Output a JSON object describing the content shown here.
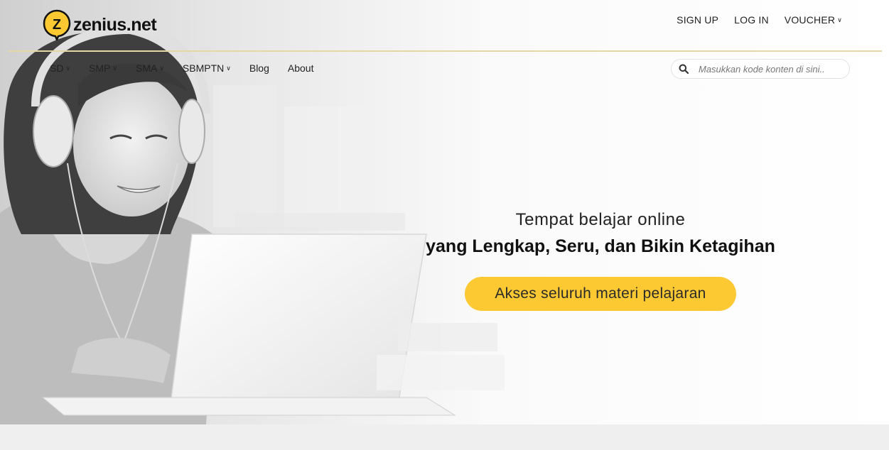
{
  "brand": {
    "name": "zenius.net",
    "logo_letter": "Z",
    "accent": "#fcc933"
  },
  "top_nav": {
    "sign_up": "SIGN UP",
    "log_in": "LOG IN",
    "voucher": "VOUCHER"
  },
  "main_nav": {
    "items": [
      {
        "label": "SD",
        "dropdown": true
      },
      {
        "label": "SMP",
        "dropdown": true
      },
      {
        "label": "SMA",
        "dropdown": true
      },
      {
        "label": "SBMPTN",
        "dropdown": true
      },
      {
        "label": "Blog",
        "dropdown": false
      },
      {
        "label": "About",
        "dropdown": false
      }
    ]
  },
  "search": {
    "placeholder": "Masukkan kode konten di sini..",
    "icon": "search-icon"
  },
  "hero": {
    "tagline_line1": "Tempat belajar online",
    "tagline_line2": "yang Lengkap, Seru, dan Bikin Ketagihan",
    "cta_label": "Akses seluruh materi pelajaran"
  },
  "colors": {
    "divider": "#e4d6a6",
    "cta": "#fcc933",
    "footer_band": "#efefef"
  }
}
